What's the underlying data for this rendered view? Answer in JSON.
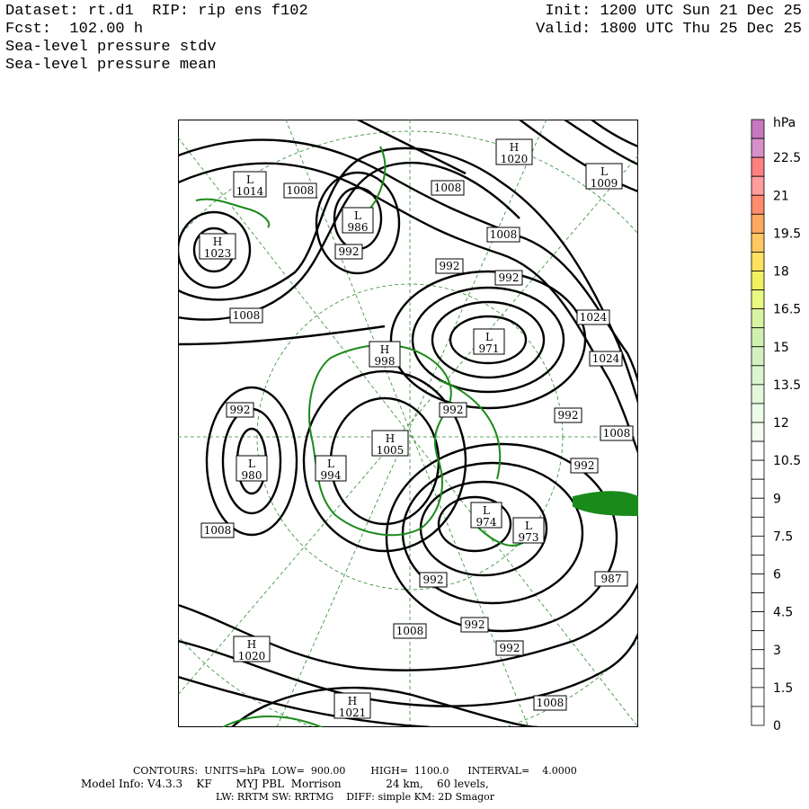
{
  "header": {
    "dataset_line": "Dataset: rt.d1  RIP: rip ens f102",
    "fcst_line": "Fcst:  102.00 h",
    "field1": "Sea-level pressure stdv",
    "field2": "Sea-level pressure mean",
    "init_line": "Init: 1200 UTC Sun 21 Dec 25",
    "valid_line": "Valid: 1800 UTC Thu 25 Dec 25"
  },
  "colors": {
    "coast": "#1a8a1a",
    "grid": "#2e8b2e",
    "contour": "#000000"
  },
  "map": {
    "centers": [
      {
        "type": "H",
        "value": "1020"
      },
      {
        "type": "L",
        "value": "1009"
      },
      {
        "type": "L",
        "value": "1014"
      },
      {
        "type": "H",
        "value": "1023"
      },
      {
        "type": "L",
        "value": "986"
      },
      {
        "type": "L",
        "value": "971"
      },
      {
        "type": "H",
        "value": "998"
      },
      {
        "type": "L",
        "value": "980"
      },
      {
        "type": "H",
        "value": "1005"
      },
      {
        "type": "L",
        "value": "994"
      },
      {
        "type": "L",
        "value": "974"
      },
      {
        "type": "L",
        "value": "973"
      },
      {
        "type": "H",
        "value": "1020"
      },
      {
        "type": "H",
        "value": "1021"
      }
    ],
    "contour_labels": [
      "1008",
      "1008",
      "1008",
      "992",
      "992",
      "992",
      "1024",
      "1024",
      "1008",
      "992",
      "992",
      "992",
      "992",
      "1008",
      "992",
      "1008",
      "992",
      "992",
      "1008",
      "1008",
      "987"
    ]
  },
  "scale": {
    "unit": "hPa",
    "ticks": [
      "22.5",
      "21",
      "19.5",
      "18",
      "16.5",
      "15",
      "13.5",
      "12",
      "10.5",
      "9",
      "7.5",
      "6",
      "4.5",
      "3",
      "1.5",
      "0"
    ],
    "colors": [
      "#c878c0",
      "#d890c8",
      "#ff8080",
      "#ff9c9c",
      "#ff8c6c",
      "#ffa860",
      "#ffc860",
      "#ffe060",
      "#f0f060",
      "#e8f880",
      "#d8f4a0",
      "#d0f0b0",
      "#d4f0c0",
      "#dcf4d0",
      "#e4f8dc",
      "#ecfce8",
      "#f4fef0",
      "#ffffff",
      "#ffffff",
      "#ffffff",
      "#ffffff",
      "#ffffff",
      "#ffffff",
      "#ffffff",
      "#ffffff",
      "#ffffff",
      "#ffffff",
      "#ffffff",
      "#ffffff",
      "#ffffff",
      "#ffffff",
      "#ffffff"
    ]
  },
  "footer": {
    "line1": "CONTOURS:  UNITS=hPa  LOW=  900.00        HIGH=  1100.0      INTERVAL=    4.0000",
    "line2": "Model Info: V4.3.3    KF       MYJ PBL  Morrison             24 km,    60 levels,",
    "line3": "LW: RRTM SW: RRTMG    DIFF: simple KM: 2D Smagor"
  }
}
